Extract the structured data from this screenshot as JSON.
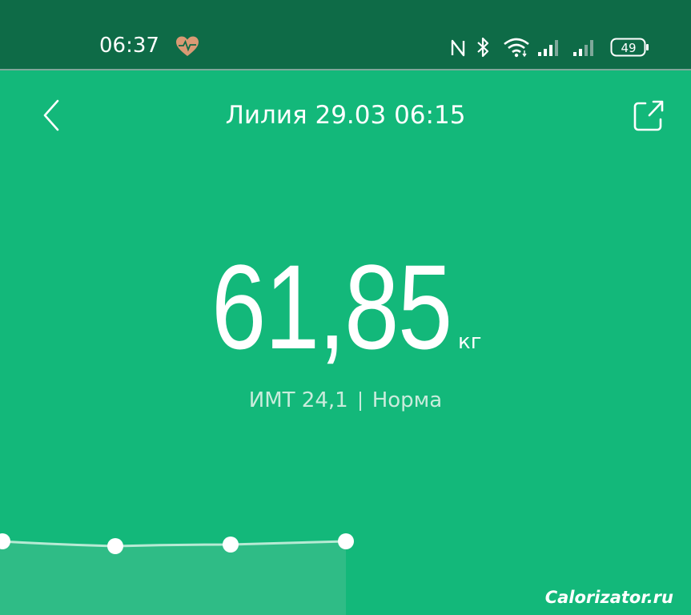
{
  "status_bar": {
    "time": "06:37",
    "battery": "49",
    "icons": [
      "heart-icon",
      "nfc-icon",
      "bluetooth-icon",
      "wifi-icon",
      "signal-icon",
      "signal-icon",
      "battery-icon"
    ]
  },
  "header": {
    "title": "Лилия 29.03 06:15"
  },
  "measurement": {
    "weight": "61,85",
    "unit": "кг",
    "bmi_label": "ИМТ 24,1",
    "status": "Норма"
  },
  "trend": {
    "points": 4
  },
  "watermark": "Calorizator.ru",
  "colors": {
    "background": "#13b87a",
    "status_bar": "#0e6b47",
    "heart": "#d99a74"
  }
}
